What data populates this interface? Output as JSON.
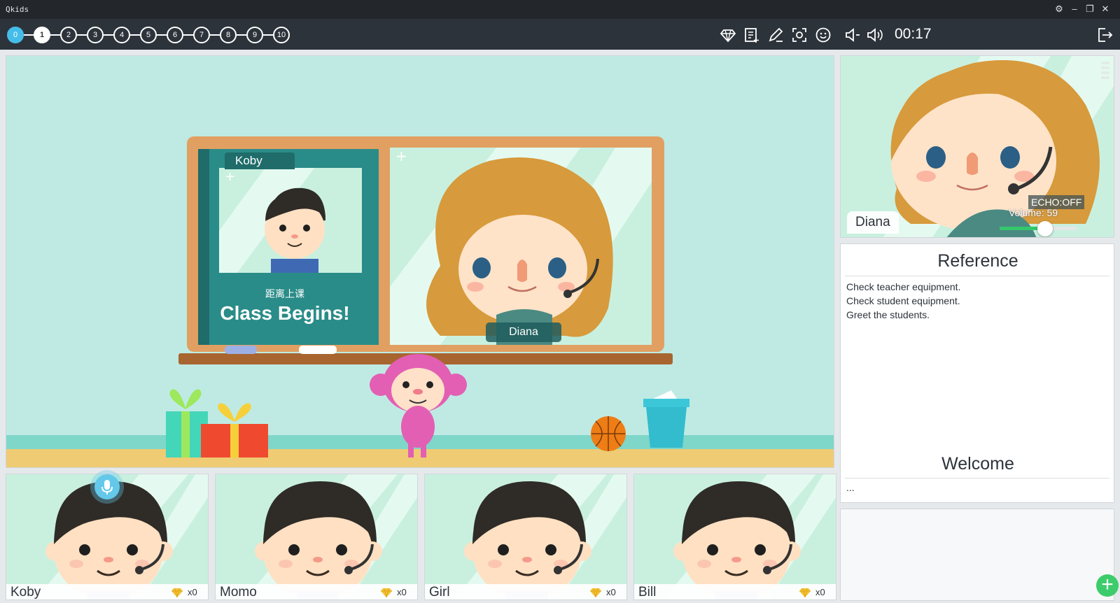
{
  "window": {
    "title": "Qkids",
    "controls": [
      "settings-icon",
      "minimize-icon",
      "restore-icon",
      "close-icon"
    ]
  },
  "toolbar": {
    "steps": [
      "0",
      "1",
      "2",
      "3",
      "4",
      "5",
      "6",
      "7",
      "8",
      "9",
      "10"
    ],
    "current_step": "1",
    "tools": [
      "diamond-icon",
      "add-note-icon",
      "pen-icon",
      "screenshot-icon",
      "emoji-icon",
      "volume-down-icon",
      "volume-up-icon"
    ],
    "timer": "00:17",
    "exit_icon": "exit-icon"
  },
  "stage": {
    "board_student_name": "Koby",
    "countdown_label": "距离上课",
    "countdown_text": "Class Begins!",
    "board_teacher_name": "Diana"
  },
  "teacher": {
    "name": "Diana",
    "echo": "ECHO:OFF",
    "volume_label": "Volume: 59",
    "volume": 59
  },
  "reference": {
    "title": "Reference",
    "lines": [
      "Check teacher equipment.",
      "Check student equipment.",
      "Greet the students."
    ],
    "welcome_title": "Welcome",
    "welcome_text": "..."
  },
  "students": [
    {
      "name": "Koby",
      "count": "x0"
    },
    {
      "name": "Momo",
      "count": "x0"
    },
    {
      "name": "Girl",
      "count": "x0"
    },
    {
      "name": "Bill",
      "count": "x0"
    }
  ],
  "colors": {
    "accent": "#45bde9",
    "toolbar": "#2d333b",
    "green": "#3dcc6c",
    "board": "#e1a061"
  }
}
